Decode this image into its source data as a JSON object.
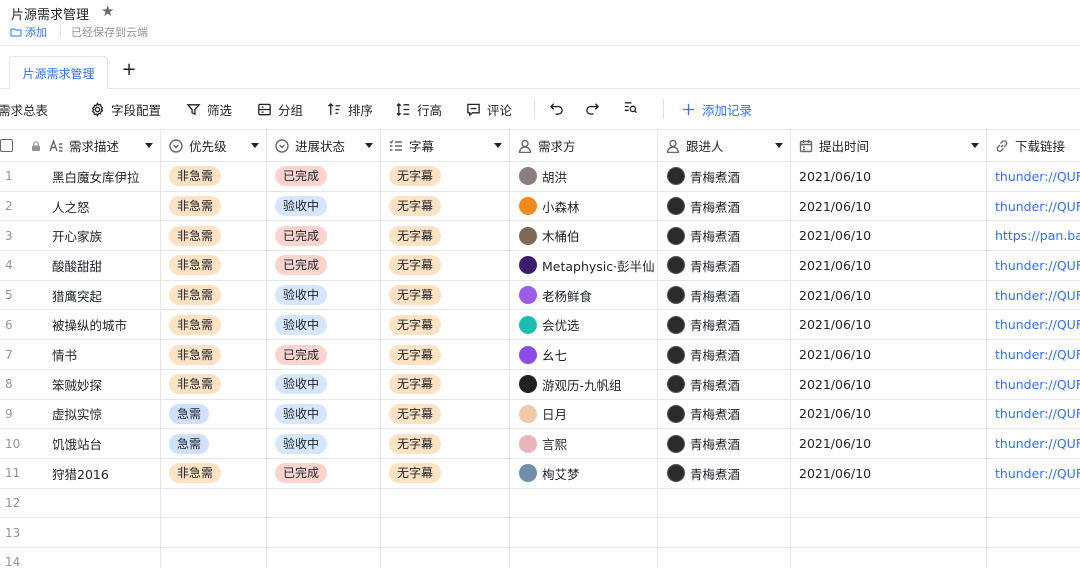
{
  "header": {
    "title": "片源需求管理",
    "add_label": "添加",
    "saved_text": "已经保存到云端"
  },
  "tabs": [
    {
      "label": "片源需求管理"
    }
  ],
  "toolbar": {
    "view_name": "需求总表",
    "field_config": "字段配置",
    "filter": "筛选",
    "group": "分组",
    "sort": "排序",
    "row_height": "行高",
    "comment": "评论",
    "add_record": "添加记录"
  },
  "columns": [
    {
      "name": "需求描述",
      "icon": "text-icon"
    },
    {
      "name": "优先级",
      "icon": "single-select-icon"
    },
    {
      "name": "进展状态",
      "icon": "single-select-icon"
    },
    {
      "name": "字幕",
      "icon": "multi-select-icon"
    },
    {
      "name": "需求方",
      "icon": "person-icon"
    },
    {
      "name": "跟进人",
      "icon": "person-icon"
    },
    {
      "name": "提出时间",
      "icon": "calendar-icon"
    },
    {
      "name": "下载链接",
      "icon": "link-icon"
    }
  ],
  "colors": {
    "accent": "#3370ff",
    "tag_orange": "#fde2c4",
    "tag_red": "#fbd4d0",
    "tag_blue": "#d6e6ff"
  },
  "rows": [
    {
      "num": "1",
      "desc": "黑白魔女库伊拉",
      "priority": "非急需",
      "status": "已完成",
      "subtitle": "无字幕",
      "requester": "胡洪",
      "req_color": "#8a7f7a",
      "follower": "青梅煮酒",
      "date": "2021/06/10",
      "link": "thunder://QUFt"
    },
    {
      "num": "2",
      "desc": "人之怒",
      "priority": "非急需",
      "status": "验收中",
      "subtitle": "无字幕",
      "requester": "小森林",
      "req_color": "#f08a1c",
      "follower": "青梅煮酒",
      "date": "2021/06/10",
      "link": "thunder://QUFt"
    },
    {
      "num": "3",
      "desc": "开心家族",
      "priority": "非急需",
      "status": "已完成",
      "subtitle": "无字幕",
      "requester": "木桶伯",
      "req_color": "#7d6b55",
      "follower": "青梅煮酒",
      "date": "2021/06/10",
      "link": "https://pan.bai"
    },
    {
      "num": "4",
      "desc": "酸酸甜甜",
      "priority": "非急需",
      "status": "已完成",
      "subtitle": "无字幕",
      "requester": "Metaphysic·彭半仙",
      "req_color": "#3b1f6e",
      "follower": "青梅煮酒",
      "date": "2021/06/10",
      "link": "thunder://QUFt"
    },
    {
      "num": "5",
      "desc": "猎鹰突起",
      "priority": "非急需",
      "status": "验收中",
      "subtitle": "无字幕",
      "requester": "老杨鲜食",
      "req_color": "#9b5de5",
      "follower": "青梅煮酒",
      "date": "2021/06/10",
      "link": "thunder://QUFt"
    },
    {
      "num": "6",
      "desc": "被操纵的城市",
      "priority": "非急需",
      "status": "验收中",
      "subtitle": "无字幕",
      "requester": "会优选",
      "req_color": "#1bbfb0",
      "follower": "青梅煮酒",
      "date": "2021/06/10",
      "link": "thunder://QUFt"
    },
    {
      "num": "7",
      "desc": "情书",
      "priority": "非急需",
      "status": "已完成",
      "subtitle": "无字幕",
      "requester": "幺七",
      "req_color": "#8a4de8",
      "follower": "青梅煮酒",
      "date": "2021/06/10",
      "link": "thunder://QUFt"
    },
    {
      "num": "8",
      "desc": "笨贼妙探",
      "priority": "非急需",
      "status": "验收中",
      "subtitle": "无字幕",
      "requester": "游观历-九帆组",
      "req_color": "#222222",
      "follower": "青梅煮酒",
      "date": "2021/06/10",
      "link": "thunder://QUFt"
    },
    {
      "num": "9",
      "desc": "虚拟实惊",
      "priority": "急需",
      "status": "验收中",
      "subtitle": "无字幕",
      "requester": "日月",
      "req_color": "#f2c9a8",
      "follower": "青梅煮酒",
      "date": "2021/06/10",
      "link": "thunder://QUFt"
    },
    {
      "num": "10",
      "desc": "饥饿站台",
      "priority": "急需",
      "status": "验收中",
      "subtitle": "无字幕",
      "requester": "言熙",
      "req_color": "#e8b6b6",
      "follower": "青梅煮酒",
      "date": "2021/06/10",
      "link": "thunder://QUFt"
    },
    {
      "num": "11",
      "desc": "狩猎2016",
      "priority": "非急需",
      "status": "已完成",
      "subtitle": "无字幕",
      "requester": "栒艾梦",
      "req_color": "#6f8fa8",
      "follower": "青梅煮酒",
      "date": "2021/06/10",
      "link": "thunder://QUFt"
    }
  ],
  "empty_rows": [
    "12",
    "13",
    "14"
  ]
}
